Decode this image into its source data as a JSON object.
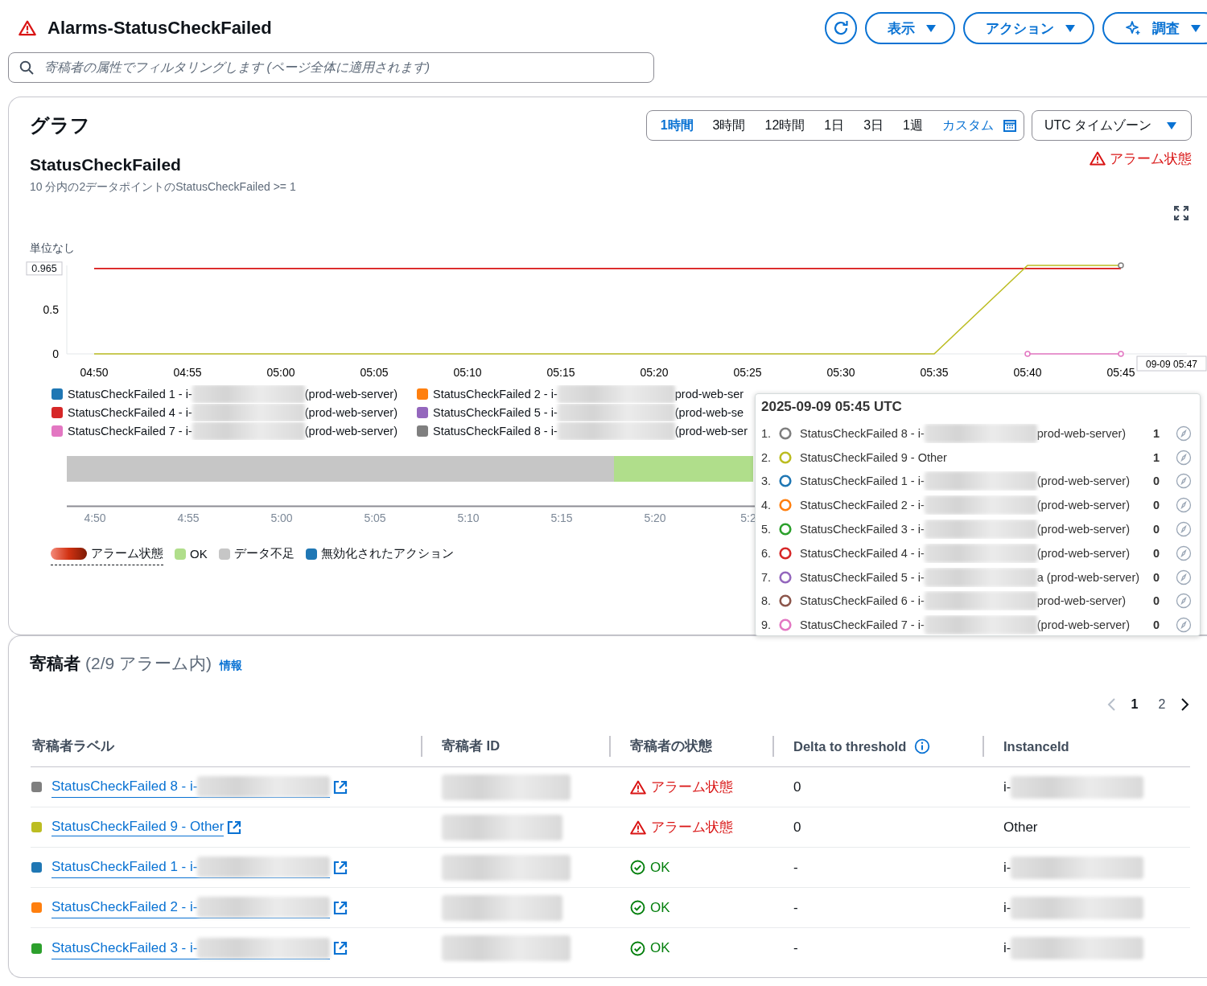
{
  "header": {
    "title": "Alarms-StatusCheckFailed",
    "buttons": [
      {
        "kind": "refresh"
      },
      {
        "kind": "dropdown",
        "label": "表示"
      },
      {
        "kind": "dropdown",
        "label": "アクション"
      },
      {
        "kind": "sparkle",
        "label": "調査"
      }
    ],
    "search": {
      "placeholder": "寄稿者の属性でフィルタリングします (ページ全体に適用されます)"
    }
  },
  "graph": {
    "title": "グラフ",
    "time_ranges": [
      {
        "label": "1時間",
        "kind": "preset",
        "selected": true
      },
      {
        "label": "3時間",
        "kind": "preset",
        "selected": false
      },
      {
        "label": "12時間",
        "kind": "preset",
        "selected": false
      },
      {
        "label": "1日",
        "kind": "preset",
        "selected": false
      },
      {
        "label": "3日",
        "kind": "preset",
        "selected": false
      },
      {
        "label": "1週",
        "kind": "preset",
        "selected": false
      },
      {
        "label": "カスタム",
        "kind": "custom",
        "selected": false
      }
    ],
    "timezone": "UTC タイムゾーン",
    "alarm_title": "StatusCheckFailed",
    "alarm_state": "アラーム状態",
    "condition": "10 分内の2データポイントのStatusCheckFailed >= 1",
    "cursor_label": "09-09 05:47",
    "chart_data": {
      "type": "line",
      "ylabel": "単位なし",
      "x": [
        "04:50",
        "04:55",
        "05:00",
        "05:05",
        "05:10",
        "05:15",
        "05:20",
        "05:25",
        "05:30",
        "05:35",
        "05:40",
        "05:45"
      ],
      "ylim": [
        0,
        1
      ],
      "yticks": [
        0,
        0.5,
        {
          "value": 0.965,
          "label": "0.965"
        }
      ],
      "series": [
        {
          "color": "#d91515",
          "values": [
            0.965,
            0.965,
            0.965,
            0.965,
            0.965,
            0.965,
            0.965,
            0.965,
            0.965,
            0.965,
            0.965,
            0.965
          ]
        },
        {
          "color": "#bcbd22",
          "values": [
            0,
            0,
            0,
            0,
            0,
            0,
            0,
            0,
            0,
            0,
            1,
            1
          ]
        },
        {
          "color": "#e377c2",
          "marker": "circle",
          "values": [
            null,
            null,
            null,
            null,
            null,
            null,
            null,
            null,
            null,
            null,
            0,
            0
          ]
        },
        {
          "color": "#7f7f7f",
          "marker": "circle",
          "values": [
            null,
            null,
            null,
            null,
            null,
            null,
            null,
            null,
            null,
            null,
            null,
            1
          ]
        }
      ]
    },
    "legend": [
      {
        "prefix": "StatusCheckFailed 1 - i-",
        "suffix": "(prod-web-server)",
        "color": "#1f77b4"
      },
      {
        "prefix": "StatusCheckFailed 2 - i-",
        "suffix": "prod-web-ser",
        "color": "#ff7f0e"
      },
      {
        "prefix": "StatusCheckFailed 4 - i-",
        "suffix": "(prod-web-server)",
        "color": "#d62728"
      },
      {
        "prefix": "StatusCheckFailed 5 - i-",
        "suffix": "(prod-web-se",
        "color": "#9467bd"
      },
      {
        "prefix": "StatusCheckFailed 7 - i-",
        "suffix": "(prod-web-server)",
        "color": "#e377c2"
      },
      {
        "prefix": "StatusCheckFailed 8 - i-",
        "suffix": "(prod-web-ser",
        "color": "#7f7f7f"
      }
    ],
    "timeline": {
      "segments": [
        {
          "kind": "insufficient",
          "level": 0.797
        },
        {
          "kind": "ok",
          "level": 0.203
        }
      ],
      "ticks": [
        "4:50",
        "4:55",
        "5:00",
        "5:05",
        "5:10",
        "5:15",
        "5:20",
        "5:2"
      ]
    },
    "state_legend": [
      {
        "kind": "alarm",
        "label": "アラーム状態"
      },
      {
        "kind": "ok",
        "label": "OK"
      },
      {
        "kind": "insufficient",
        "label": "データ不足"
      },
      {
        "kind": "disabled",
        "label": "無効化されたアクション"
      }
    ]
  },
  "tooltip": {
    "title": "2025-09-09 05:45 UTC",
    "items": [
      {
        "index": "1.",
        "prefix": "StatusCheckFailed 8 - i-",
        "redacted": true,
        "suffix": "prod-web-server)",
        "value": "1",
        "color": "#7f7f7f"
      },
      {
        "index": "2.",
        "prefix": "StatusCheckFailed 9 - Other",
        "redacted": false,
        "value": "1",
        "color": "#bcbd22"
      },
      {
        "index": "3.",
        "prefix": "StatusCheckFailed 1 - i-",
        "redacted": true,
        "suffix": "(prod-web-server)",
        "value": "0",
        "color": "#1f77b4"
      },
      {
        "index": "4.",
        "prefix": "StatusCheckFailed 2 - i-",
        "redacted": true,
        "suffix": "(prod-web-server)",
        "value": "0",
        "color": "#ff7f0e"
      },
      {
        "index": "5.",
        "prefix": "StatusCheckFailed 3 - i-",
        "redacted": true,
        "suffix": "(prod-web-server)",
        "value": "0",
        "color": "#2ca02c"
      },
      {
        "index": "6.",
        "prefix": "StatusCheckFailed 4 - i-",
        "redacted": true,
        "suffix": "(prod-web-server)",
        "value": "0",
        "color": "#d62728"
      },
      {
        "index": "7.",
        "prefix": "StatusCheckFailed 5 - i-",
        "redacted": true,
        "suffix": "a (prod-web-server)",
        "value": "0",
        "color": "#9467bd"
      },
      {
        "index": "8.",
        "prefix": "StatusCheckFailed 6 - i-",
        "redacted": true,
        "suffix": "prod-web-server)",
        "value": "0",
        "color": "#8c564b"
      },
      {
        "index": "9.",
        "prefix": "StatusCheckFailed 7 - i-",
        "redacted": true,
        "suffix": "(prod-web-server)",
        "value": "0",
        "color": "#e377c2"
      }
    ]
  },
  "contributors": {
    "title": "寄稿者",
    "count": "(2/9 アラーム内)",
    "info_link": "情報",
    "pages": [
      {
        "label": "1",
        "selected": true
      },
      {
        "label": "2",
        "selected": false
      }
    ],
    "columns": [
      "寄稿者ラベル",
      "寄稿者 ID",
      "寄稿者の状態",
      "Delta to threshold",
      "InstanceId"
    ],
    "rows": [
      {
        "label": "StatusCheckFailed 8 - i-",
        "redacted": true,
        "color": "#7f7f7f",
        "state": "アラーム状態",
        "kind": "alarm",
        "delta": "0",
        "instance": "i-",
        "instance_redacted": true
      },
      {
        "label": "StatusCheckFailed 9 - Other",
        "redacted": false,
        "color": "#bcbd22",
        "state": "アラーム状態",
        "kind": "alarm",
        "delta": "0",
        "instance": "Other",
        "instance_redacted": false
      },
      {
        "label": "StatusCheckFailed 1 - i-",
        "redacted": true,
        "color": "#1f77b4",
        "state": "OK",
        "kind": "ok",
        "delta": "-",
        "instance": "i-",
        "instance_redacted": true
      },
      {
        "label": "StatusCheckFailed 2 - i-",
        "redacted": true,
        "color": "#ff7f0e",
        "state": "OK",
        "kind": "ok",
        "delta": "-",
        "instance": "i-",
        "instance_redacted": true
      },
      {
        "label": "StatusCheckFailed 3 - i-",
        "redacted": true,
        "color": "#2ca02c",
        "state": "OK",
        "kind": "ok",
        "delta": "-",
        "instance": "i-",
        "instance_redacted": true
      }
    ]
  }
}
